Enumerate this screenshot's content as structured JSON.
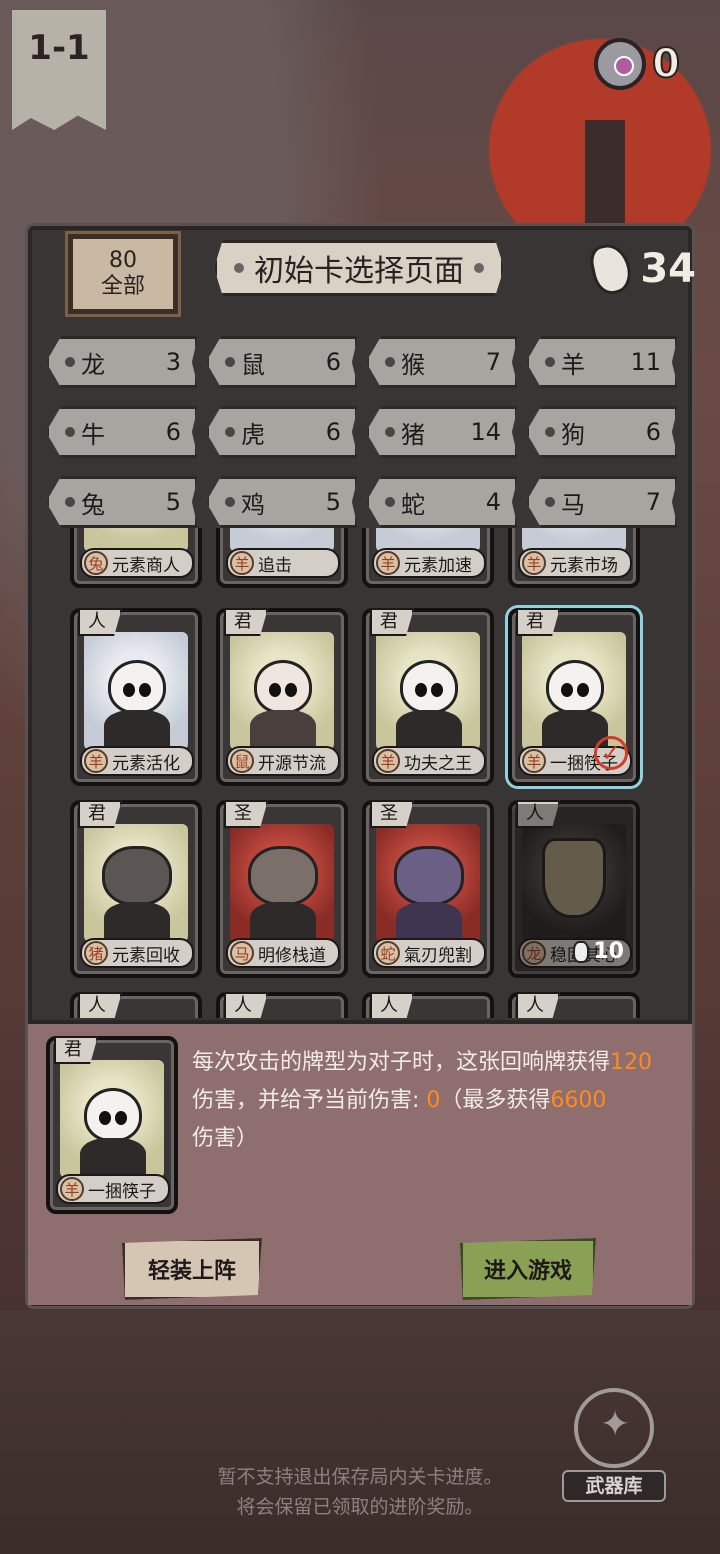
{
  "stage": "1-1",
  "currency": {
    "icon": "gem-icon",
    "value": "0"
  },
  "header": {
    "all_count": "80",
    "all_label": "全部",
    "title": "初始卡选择页面",
    "card_count": "34"
  },
  "filters": [
    {
      "name": "龙",
      "count": "3"
    },
    {
      "name": "鼠",
      "count": "6"
    },
    {
      "name": "猴",
      "count": "7"
    },
    {
      "name": "羊",
      "count": "11"
    },
    {
      "name": "牛",
      "count": "6"
    },
    {
      "name": "虎",
      "count": "6"
    },
    {
      "name": "猪",
      "count": "14"
    },
    {
      "name": "狗",
      "count": "6"
    },
    {
      "name": "兔",
      "count": "5"
    },
    {
      "name": "鸡",
      "count": "5"
    },
    {
      "name": "蛇",
      "count": "4"
    },
    {
      "name": "马",
      "count": "7"
    }
  ],
  "cards_top_row": [
    {
      "zodiac": "兔",
      "name": "元素商人"
    },
    {
      "zodiac": "羊",
      "name": "追击"
    },
    {
      "zodiac": "羊",
      "name": "元素加速"
    },
    {
      "zodiac": "羊",
      "name": "元素市场"
    }
  ],
  "cards_row2": [
    {
      "rank": "人",
      "zodiac": "羊",
      "name": "元素活化"
    },
    {
      "rank": "君",
      "zodiac": "鼠",
      "name": "开源节流"
    },
    {
      "rank": "君",
      "zodiac": "羊",
      "name": "功夫之王"
    },
    {
      "rank": "君",
      "zodiac": "羊",
      "name": "一捆筷子",
      "selected": true
    }
  ],
  "cards_row3": [
    {
      "rank": "君",
      "zodiac": "猪",
      "name": "元素回收"
    },
    {
      "rank": "圣",
      "zodiac": "马",
      "name": "明修栈道"
    },
    {
      "rank": "圣",
      "zodiac": "蛇",
      "name": "氣刃兜割"
    },
    {
      "rank": "人",
      "zodiac": "龙",
      "name": "稳固其心",
      "locked": true,
      "cost": "10"
    }
  ],
  "cards_row4_ranks": [
    "人",
    "人",
    "人",
    "人"
  ],
  "detail": {
    "rank": "君",
    "zodiac": "羊",
    "name": "一捆筷子",
    "text_part1": "每次攻击的牌型为对子时，这张回响牌获得",
    "value1": "120",
    "text_part2": "伤害，并给予当前伤害: ",
    "value2": "0",
    "text_part3": "（最多获得",
    "value3": "6600",
    "text_part4": "伤害）"
  },
  "buttons": {
    "quick_deploy": "轻装上阵",
    "enter_game": "进入游戏"
  },
  "notice": {
    "line1": "暂不支持退出保存局内关卡进度。",
    "line2": "将会保留已领取的进阶奖励。"
  },
  "armory_label": "武器库"
}
